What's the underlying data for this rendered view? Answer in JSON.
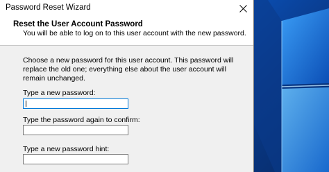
{
  "window": {
    "title": "Password Reset Wizard",
    "close_icon": "close-icon"
  },
  "header": {
    "title": "Reset the User Account Password",
    "subtitle": "You will be able to log on to this user account with the new password."
  },
  "main": {
    "description": "Choose a new password for this user account. This password will replace the old one; everything else about the user account will remain unchanged.",
    "fields": [
      {
        "label": "Type a new password:",
        "value": ""
      },
      {
        "label": "Type the password again to confirm:",
        "value": ""
      },
      {
        "label": "Type a new password hint:",
        "value": ""
      }
    ]
  },
  "colors": {
    "dialog_bg": "#f0f0f0",
    "header_bg": "#ffffff",
    "focus_border": "#0078d7",
    "desktop_blue": "#0a58c6"
  }
}
